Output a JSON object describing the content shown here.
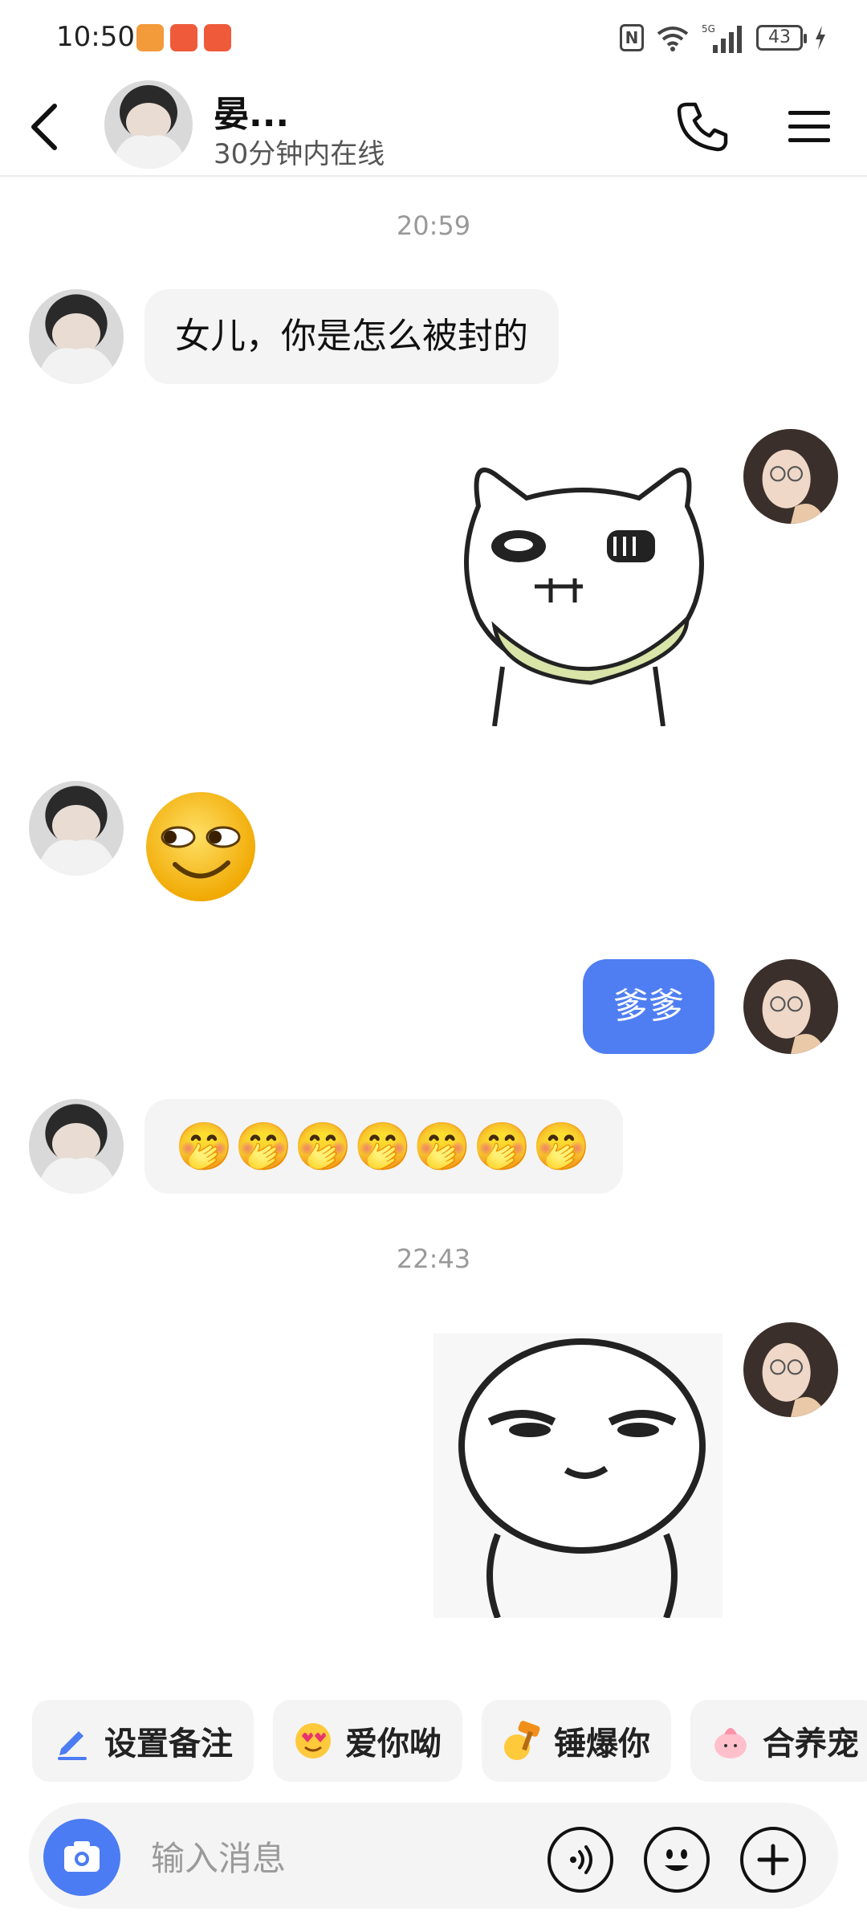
{
  "status_bar": {
    "time": "10:50",
    "battery": "43",
    "network": "5G"
  },
  "header": {
    "name": "晏...",
    "status": "30分钟内在线"
  },
  "chat": {
    "timestamps": [
      "20:59",
      "22:43"
    ],
    "messages": {
      "m1": "女儿，你是怎么被封的",
      "m4": "爹爹",
      "m5": "🤭🤭🤭🤭🤭🤭🤭"
    }
  },
  "quick_actions": [
    {
      "label": "设置备注",
      "icon": "pencil-icon"
    },
    {
      "label": "爱你呦",
      "icon": "heart-face-icon"
    },
    {
      "label": "锤爆你",
      "icon": "hammer-icon"
    },
    {
      "label": "合养宠",
      "icon": "pet-icon"
    }
  ],
  "input": {
    "placeholder": "输入消息"
  },
  "colors": {
    "accent": "#4f7ef3",
    "bubble_in": "#f4f4f5",
    "background": "#ffffff"
  }
}
